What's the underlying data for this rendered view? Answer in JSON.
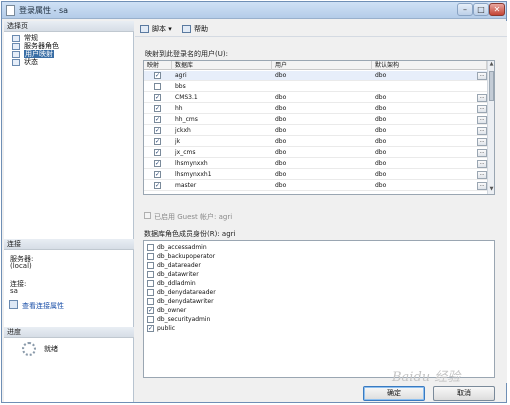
{
  "window": {
    "title": "登录属性 - sa"
  },
  "left": {
    "select_page_header": "选择页",
    "nav": [
      {
        "label": "常规",
        "selected": false
      },
      {
        "label": "服务器角色",
        "selected": false
      },
      {
        "label": "用户映射",
        "selected": true
      },
      {
        "label": "状态",
        "selected": false
      }
    ],
    "connection_header": "连接",
    "server_label": "服务器:",
    "server_value": "(local)",
    "connection_label": "连接:",
    "connection_value": "sa",
    "view_connection_link": "查看连接属性",
    "progress_header": "进度",
    "progress_status": "就绪"
  },
  "toolbar": {
    "script_label": "脚本",
    "help_label": "帮助"
  },
  "mapping": {
    "section_label": "映射到此登录名的用户(U):",
    "columns": [
      "映射",
      "数据库",
      "用户",
      "默认架构"
    ],
    "rows": [
      {
        "mapped": true,
        "database": "agri",
        "user": "dbo",
        "schema": "dbo"
      },
      {
        "mapped": false,
        "database": "bbs",
        "user": "",
        "schema": ""
      },
      {
        "mapped": true,
        "database": "CMS3.1",
        "user": "dbo",
        "schema": "dbo"
      },
      {
        "mapped": true,
        "database": "hh",
        "user": "dbo",
        "schema": "dbo"
      },
      {
        "mapped": true,
        "database": "hh_cms",
        "user": "dbo",
        "schema": "dbo"
      },
      {
        "mapped": true,
        "database": "jckxh",
        "user": "dbo",
        "schema": "dbo"
      },
      {
        "mapped": true,
        "database": "jk",
        "user": "dbo",
        "schema": "dbo"
      },
      {
        "mapped": true,
        "database": "jx_cms",
        "user": "dbo",
        "schema": "dbo"
      },
      {
        "mapped": true,
        "database": "lhsmynxxh",
        "user": "dbo",
        "schema": "dbo"
      },
      {
        "mapped": true,
        "database": "lhsmynxxh1",
        "user": "dbo",
        "schema": "dbo"
      },
      {
        "mapped": true,
        "database": "master",
        "user": "dbo",
        "schema": "dbo"
      }
    ]
  },
  "guest": {
    "label": "已启用 Guest 帐户: agri"
  },
  "roles": {
    "section_label": "数据库角色成员身份(R): agri",
    "items": [
      {
        "name": "db_accessadmin",
        "checked": false
      },
      {
        "name": "db_backupoperator",
        "checked": false
      },
      {
        "name": "db_datareader",
        "checked": false
      },
      {
        "name": "db_datawriter",
        "checked": false
      },
      {
        "name": "db_ddladmin",
        "checked": false
      },
      {
        "name": "db_denydatareader",
        "checked": false
      },
      {
        "name": "db_denydatawriter",
        "checked": false
      },
      {
        "name": "db_owner",
        "checked": true
      },
      {
        "name": "db_securityadmin",
        "checked": false
      },
      {
        "name": "public",
        "checked": true
      }
    ]
  },
  "buttons": {
    "ok": "确定",
    "cancel": "取消"
  },
  "watermark": "Baidu 经验"
}
